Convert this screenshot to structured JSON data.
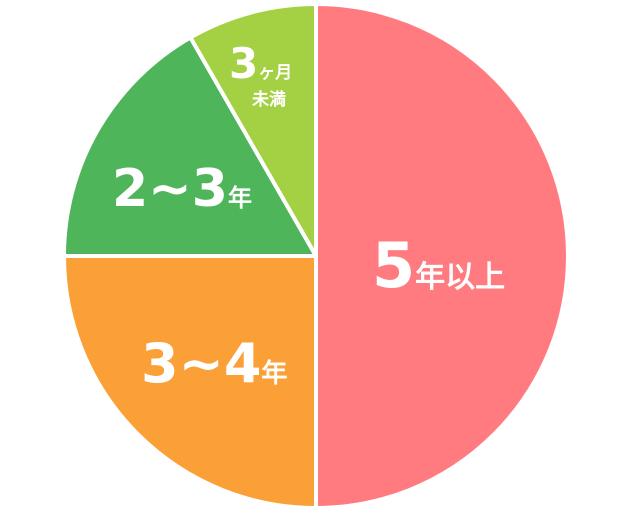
{
  "chart_data": {
    "type": "pie",
    "start_angle_deg": 0,
    "direction": "clockwise",
    "slice_border_color": "#ffffff",
    "slices": [
      {
        "key": "5y-plus",
        "value": 50,
        "color": "#ff7b80",
        "label_number": "5",
        "label_unit": "年以上"
      },
      {
        "key": "3-4y",
        "value": 25,
        "color": "#fb9f37",
        "label_number": "3~4",
        "label_unit": "年"
      },
      {
        "key": "2-3y",
        "value": 16.7,
        "color": "#4fb55a",
        "label_number": "2~3",
        "label_unit": "年"
      },
      {
        "key": "under-3m",
        "value": 8.3,
        "color": "#a4d044",
        "label_number": "3",
        "label_unit": "ヶ月",
        "label_unit_line2": "未満"
      }
    ]
  }
}
